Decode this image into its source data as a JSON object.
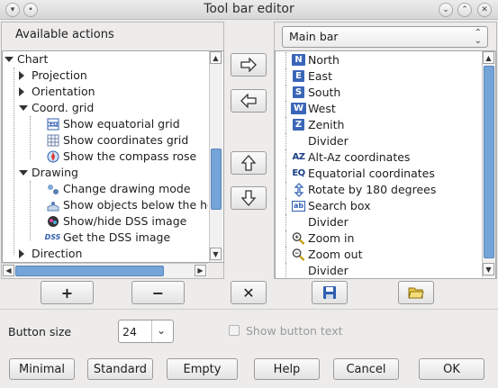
{
  "window": {
    "title": "Tool bar editor"
  },
  "left_panel": {
    "heading": "Available actions",
    "tree": [
      {
        "label": "Chart",
        "kind": "open"
      },
      {
        "label": "Projection",
        "kind": "closed"
      },
      {
        "label": "Orientation",
        "kind": "closed"
      },
      {
        "label": "Coord. grid",
        "kind": "open"
      },
      {
        "label": "Show equatorial grid",
        "icon": "equatorial-grid-icon"
      },
      {
        "label": "Show coordinates grid",
        "icon": "coordinates-grid-icon"
      },
      {
        "label": "Show the compass rose",
        "icon": "compass-icon"
      },
      {
        "label": "Drawing",
        "kind": "open"
      },
      {
        "label": "Change drawing mode",
        "icon": "drawing-mode-icon"
      },
      {
        "label": "Show objects below the ho",
        "icon": "horizon-objects-icon"
      },
      {
        "label": "Show/hide DSS image",
        "icon": "dss-toggle-icon"
      },
      {
        "label": "Get the DSS image",
        "icon": "dss-icon",
        "icon_text": "DSS"
      },
      {
        "label": "Direction",
        "kind": "closed"
      }
    ]
  },
  "right_panel": {
    "toolbar_select": "Main bar",
    "items": [
      {
        "label": "North",
        "icon": "north-icon",
        "icon_text": "N"
      },
      {
        "label": "East",
        "icon": "east-icon",
        "icon_text": "E"
      },
      {
        "label": "South",
        "icon": "south-icon",
        "icon_text": "S"
      },
      {
        "label": "West",
        "icon": "west-icon",
        "icon_text": "W"
      },
      {
        "label": "Zenith",
        "icon": "zenith-icon",
        "icon_text": "Z"
      },
      {
        "label": "Divider",
        "icon": ""
      },
      {
        "label": "Alt-Az coordinates",
        "icon": "altaz-icon",
        "icon_text": "AZ"
      },
      {
        "label": "Equatorial coordinates",
        "icon": "eq-icon",
        "icon_text": "EQ"
      },
      {
        "label": "Rotate by 180 degrees",
        "icon": "rotate-icon"
      },
      {
        "label": "Search box",
        "icon": "search-box-icon",
        "icon_text": "ab"
      },
      {
        "label": "Divider",
        "icon": ""
      },
      {
        "label": "Zoom in",
        "icon": "zoom-in-icon"
      },
      {
        "label": "Zoom out",
        "icon": "zoom-out-icon"
      },
      {
        "label": "Divider",
        "icon": ""
      }
    ]
  },
  "bottom": {
    "button_size_label": "Button size",
    "button_size_value": "24",
    "show_text_label": "Show button text",
    "buttons": {
      "minimal": "Minimal",
      "standard": "Standard",
      "empty": "Empty",
      "help": "Help",
      "cancel": "Cancel",
      "ok": "OK"
    }
  },
  "colors": {
    "accent": "#74a4d8",
    "icon_blue": "#2f5fb0"
  }
}
